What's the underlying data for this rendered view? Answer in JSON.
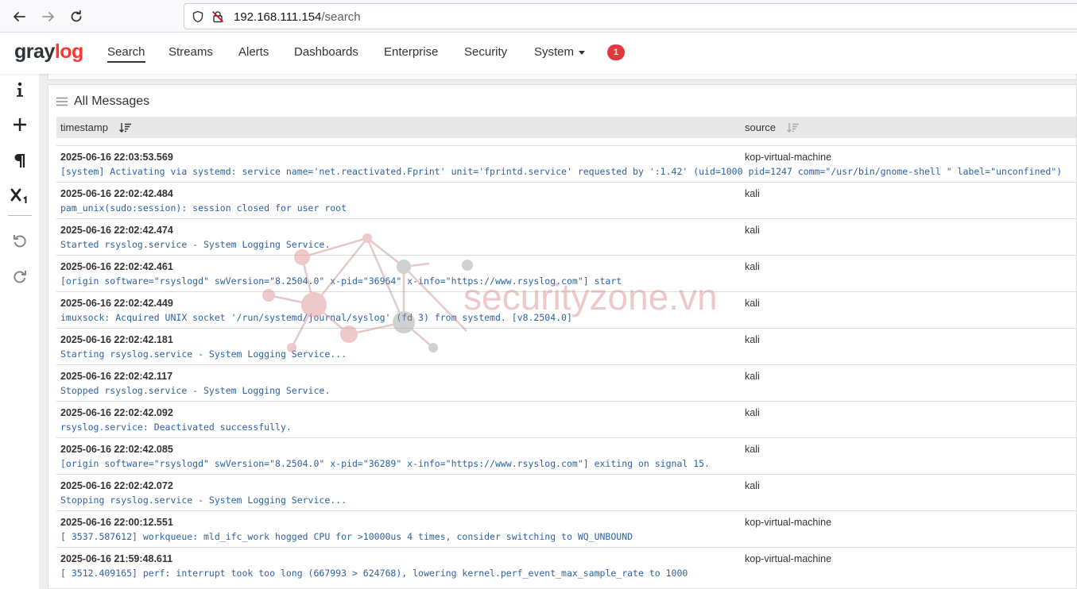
{
  "browser": {
    "url_host": "192.168.111.154",
    "url_path": "/search"
  },
  "header": {
    "logo_main": "gray",
    "logo_accent": "log",
    "nav": [
      {
        "label": "Search"
      },
      {
        "label": "Streams"
      },
      {
        "label": "Alerts"
      },
      {
        "label": "Dashboards"
      },
      {
        "label": "Enterprise"
      },
      {
        "label": "Security"
      },
      {
        "label": "System"
      }
    ],
    "notification_count": "1"
  },
  "sidebar": {
    "tools": [
      "info-icon",
      "add-icon",
      "paragraph-icon",
      "subscript-icon",
      "undo-icon",
      "redo-icon"
    ]
  },
  "widget": {
    "title": "All Messages",
    "columns": [
      "timestamp",
      "source"
    ],
    "rows": [
      {
        "timestamp": "2025-06-16 22:03:53.569",
        "source": "kop-virtual-machine",
        "message": "[system] Activating via systemd: service name='net.reactivated.Fprint' unit='fprintd.service' requested by ':1.42' (uid=1000 pid=1247 comm=\"/usr/bin/gnome-shell \" label=\"unconfined\")"
      },
      {
        "timestamp": "2025-06-16 22:02:42.484",
        "source": "kali",
        "message": "pam_unix(sudo:session): session closed for user root"
      },
      {
        "timestamp": "2025-06-16 22:02:42.474",
        "source": "kali",
        "message": "Started rsyslog.service - System Logging Service."
      },
      {
        "timestamp": "2025-06-16 22:02:42.461",
        "source": "kali",
        "message": "[origin software=\"rsyslogd\" swVersion=\"8.2504.0\" x-pid=\"36964\" x-info=\"https://www.rsyslog.com\"] start"
      },
      {
        "timestamp": "2025-06-16 22:02:42.449",
        "source": "kali",
        "message": "imuxsock: Acquired UNIX socket '/run/systemd/journal/syslog' (fd 3) from systemd. [v8.2504.0]"
      },
      {
        "timestamp": "2025-06-16 22:02:42.181",
        "source": "kali",
        "message": "Starting rsyslog.service - System Logging Service..."
      },
      {
        "timestamp": "2025-06-16 22:02:42.117",
        "source": "kali",
        "message": "Stopped rsyslog.service - System Logging Service."
      },
      {
        "timestamp": "2025-06-16 22:02:42.092",
        "source": "kali",
        "message": "rsyslog.service: Deactivated successfully."
      },
      {
        "timestamp": "2025-06-16 22:02:42.085",
        "source": "kali",
        "message": "[origin software=\"rsyslogd\" swVersion=\"8.2504.0\" x-pid=\"36289\" x-info=\"https://www.rsyslog.com\"] exiting on signal 15."
      },
      {
        "timestamp": "2025-06-16 22:02:42.072",
        "source": "kali",
        "message": "Stopping rsyslog.service - System Logging Service..."
      },
      {
        "timestamp": "2025-06-16 22:00:12.551",
        "source": "kop-virtual-machine",
        "message": "[ 3537.587612] workqueue: mld_ifc_work hogged CPU for >10000us 4 times, consider switching to WQ_UNBOUND"
      },
      {
        "timestamp": "2025-06-16 21:59:48.611",
        "source": "kop-virtual-machine",
        "message": "[ 3512.409165] perf: interrupt took too long (667993 > 624768), lowering kernel.perf_event_max_sample_rate to 1000"
      }
    ]
  },
  "watermark": {
    "text": "securityzone.vn"
  }
}
